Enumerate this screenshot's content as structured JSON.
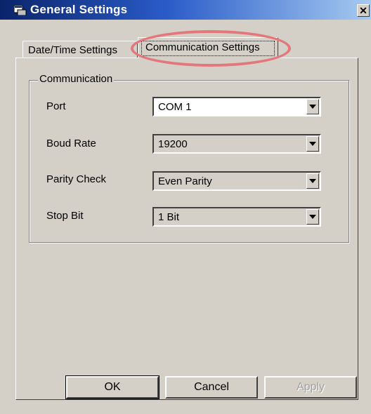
{
  "window": {
    "title": "General Settings",
    "icon": "settings-window-icon"
  },
  "tabs": [
    {
      "label": "Date/Time Settings",
      "active": false
    },
    {
      "label": "Communication Settings",
      "active": true
    }
  ],
  "group": {
    "label": "Communication",
    "fields": [
      {
        "label": "Port",
        "value": "COM 1"
      },
      {
        "label": "Boud Rate",
        "value": "19200"
      },
      {
        "label": "Parity Check",
        "value": "Even Parity"
      },
      {
        "label": "Stop Bit",
        "value": "1 Bit"
      }
    ]
  },
  "buttons": {
    "ok": "OK",
    "cancel": "Cancel",
    "apply": "Apply"
  },
  "colors": {
    "highlight": "#e3777b",
    "titlebar": "#0a246a",
    "face": "#d4d0c8"
  }
}
